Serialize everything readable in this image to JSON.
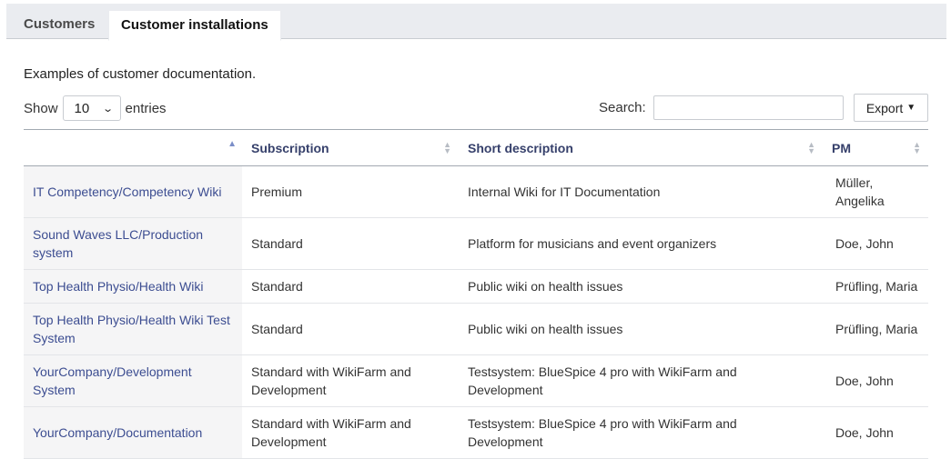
{
  "tabs": [
    {
      "label": "Customers"
    },
    {
      "label": "Customer installations"
    }
  ],
  "intro_text": "Examples of customer documentation.",
  "show_label": "Show",
  "show_value": "10",
  "entries_label": "entries",
  "search_label": "Search:",
  "search_value": "",
  "export_label": "Export",
  "table": {
    "columns": [
      "",
      "Subscription",
      "Short description",
      "PM"
    ],
    "rows": [
      {
        "installation": "IT Competency/Competency Wiki",
        "subscription": "Premium",
        "description": "Internal Wiki for IT Documentation",
        "pm": "Müller, Angelika"
      },
      {
        "installation": "Sound Waves LLC/Production system",
        "subscription": "Standard",
        "description": "Platform for musicians and event organizers",
        "pm": "Doe, John"
      },
      {
        "installation": "Top Health Physio/Health Wiki",
        "subscription": "Standard",
        "description": "Public wiki on health issues",
        "pm": "Prüfling, Maria"
      },
      {
        "installation": "Top Health Physio/Health Wiki Test System",
        "subscription": "Standard",
        "description": "Public wiki on health issues",
        "pm": "Prüfling, Maria"
      },
      {
        "installation": "YourCompany/Development System",
        "subscription": "Standard with WikiFarm and Development",
        "description": "Testsystem: BlueSpice 4 pro with WikiFarm and Development",
        "pm": "Doe, John"
      },
      {
        "installation": "YourCompany/Documentation",
        "subscription": "Standard with WikiFarm and Development",
        "description": "Testsystem: BlueSpice 4 pro with WikiFarm and Development",
        "pm": "Doe, John"
      }
    ]
  }
}
